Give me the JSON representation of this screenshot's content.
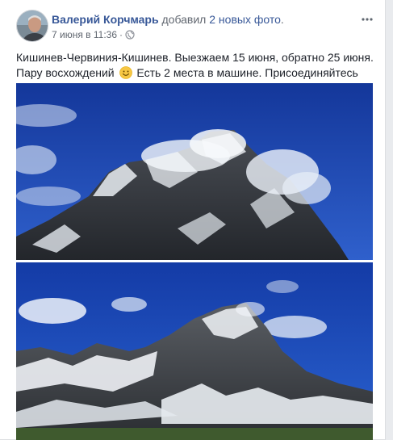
{
  "post": {
    "author": "Валерий Корчмарь",
    "action": "добавил",
    "action_link": "2 новых фото",
    "action_end": ".",
    "timestamp": "7 июня в 11:36",
    "separator": "·",
    "text_line1": "Кишинев-Червиния-Кишинев. Выезжаем 15 июня, обратно 25 июня.",
    "text_line2_a": "Пару восхождений",
    "text_line2_b": "Есть 2 места в машине. Присоединяйтесь"
  },
  "icons": {
    "avatar": "avatar",
    "globe": "globe-icon",
    "menu": "more-options-icon",
    "emoji": "smile-emoji-icon"
  },
  "colors": {
    "link": "#385898",
    "secondary": "#616770",
    "sky_top": "#1a44a8",
    "sky_bottom": "#2a5cc8"
  }
}
